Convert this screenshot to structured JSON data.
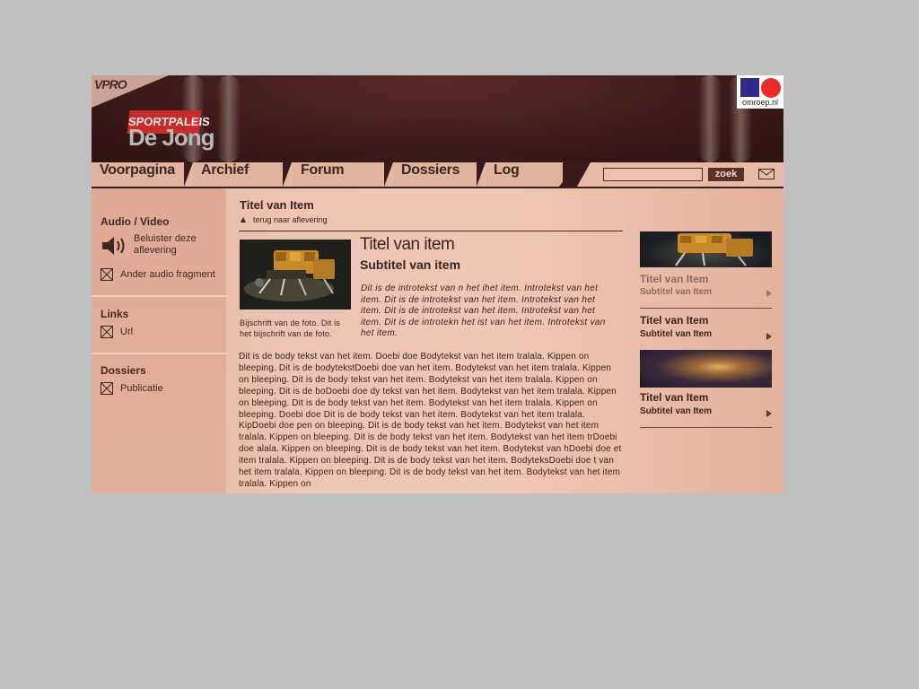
{
  "header": {
    "vpro_logo": "VPRO",
    "site_logo_top": "SPORTPALEIS",
    "site_logo_bottom": "De Jong",
    "broadcaster_label": "omroep.nl"
  },
  "nav": {
    "tabs": [
      {
        "label": "Voorpagina"
      },
      {
        "label": "Archief"
      },
      {
        "label": "Forum"
      },
      {
        "label": "Dossiers"
      },
      {
        "label": "Log"
      }
    ],
    "search_value": "",
    "search_button": "zoek",
    "mail_icon": "envelope-icon"
  },
  "sidebar": {
    "audio_heading": "Audio / Video",
    "listen_label": "Beluister deze aflevering",
    "other_audio": "Ander audio fragment",
    "links_heading": "Links",
    "url_label": "Url",
    "dossiers_heading": "Dossiers",
    "publicatie_label": "Publicatie"
  },
  "main": {
    "page_title": "Titel van Item",
    "back_link": "terug naar aflevering",
    "photo_caption": "Bijschrift van de foto. Dit is het bijschrift van de foto.",
    "item_title": "Titel van item",
    "item_subtitle": "Subtitel van item",
    "intro": "Dit is de introtekst van n het ihet item. Introtekst van het item. Dit is de introtekst van het item. Introtekst van het item. Dit is de introtekst van het item. Introtekst van het item. Dit is de introtekn het ist van het item. Introtekst van het item.",
    "body": "Dit is de body tekst van het item. Doebi doe Bodytekst van het item tralala. Kippen on bleeping. Dit is de bodytekstDoebi doe van het item. Bodytekst van het item tralala. Kippen on bleeping. Dit is de body tekst van het item. Bodytekst van het item tralala. Kippen on bleeping. Dit is de boDoebi doe dy tekst van het item. Bodytekst van het item tralala. Kippen on bleeping. Dit is de body tekst van het item. Bodytekst van het item tralala. Kippen on bleeping. Doebi doe Dit is de body tekst van het item. Bodytekst van het item tralala. KipDoebi doe pen on bleeping. Dit is de body tekst van het item. Bodytekst van het item tralala. Kippen on bleeping. Dit is de body tekst van het item. Bodytekst van het item trDoebi doe alala. Kippen on bleeping. Dit is de body tekst van het item. Bodytekst van hDoebi doe et item tralala. Kippen on bleeping. Dit is de body tekst van het item. BodyteksDoebi doe t van het item tralala. Kippen on bleeping. Dit is de body tekst van het item. Bodytekst van het item tralala. Kippen on"
  },
  "related": [
    {
      "title": "Titel van Item",
      "subtitle": "Subtitel van Item"
    },
    {
      "title": "Titel van Item",
      "subtitle": "Subtitel van Item"
    },
    {
      "title": "Titel van Item",
      "subtitle": "Subtitel van Item"
    }
  ],
  "colors": {
    "header_dark": "#3f1a1c",
    "page_bg": "#c0c0c0",
    "salmon": "#eec4b2",
    "text": "#3c2320",
    "logo_red": "#c92a2a"
  }
}
